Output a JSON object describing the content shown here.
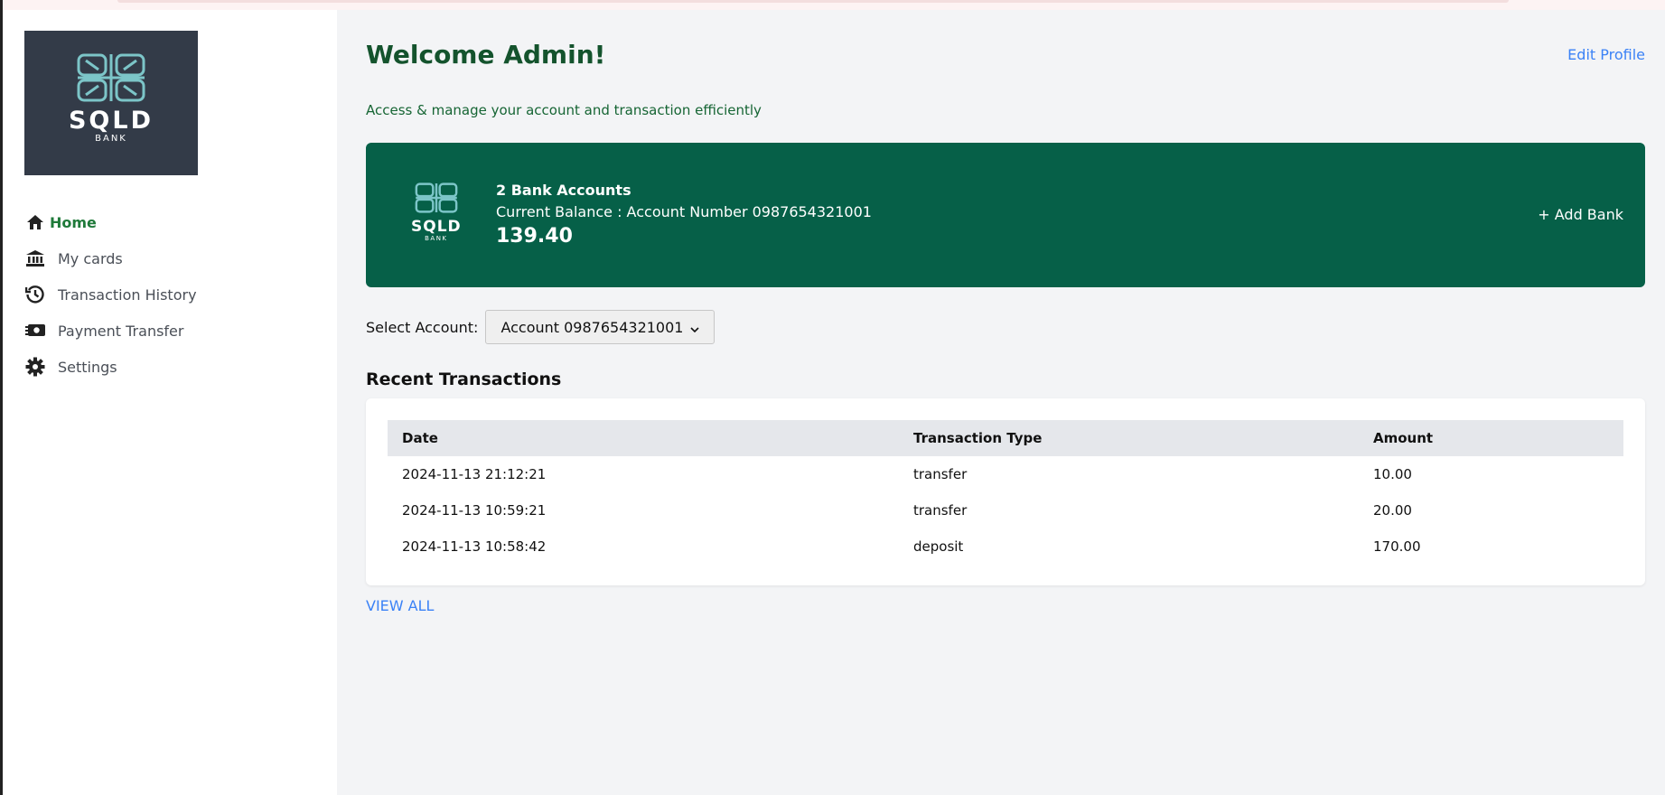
{
  "brand": {
    "name": "SQLD",
    "sub": "BANK"
  },
  "sidebar": {
    "items": [
      {
        "label": "Home"
      },
      {
        "label": "My cards"
      },
      {
        "label": "Transaction History"
      },
      {
        "label": "Payment Transfer"
      },
      {
        "label": "Settings"
      }
    ]
  },
  "header": {
    "welcome": "Welcome Admin!",
    "edit_profile": "Edit Profile",
    "subtitle": "Access & manage your account and transaction efficiently"
  },
  "bank_card": {
    "title": "2 Bank Accounts",
    "balance_label": "Current Balance : Account Number 0987654321001",
    "amount": "139.40",
    "add_bank": "+ Add Bank"
  },
  "account_select": {
    "label": "Select Account:",
    "selected": "Account 0987654321001"
  },
  "transactions": {
    "title": "Recent Transactions",
    "columns": [
      "Date",
      "Transaction Type",
      "Amount"
    ],
    "rows": [
      {
        "date": "2024-11-13 21:12:21",
        "type": "transfer",
        "amount": "10.00"
      },
      {
        "date": "2024-11-13 10:59:21",
        "type": "transfer",
        "amount": "20.00"
      },
      {
        "date": "2024-11-13 10:58:42",
        "type": "deposit",
        "amount": "170.00"
      }
    ],
    "view_all": "VIEW ALL"
  },
  "colors": {
    "primary": "#066048",
    "heading": "#14532d",
    "link": "#3b82f6",
    "logo_bg": "#333b48",
    "logo_teal": "#7cc5c8"
  }
}
